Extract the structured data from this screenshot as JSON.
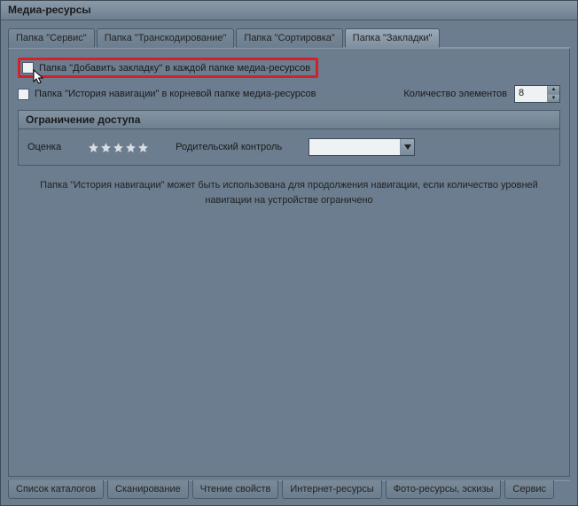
{
  "window": {
    "title": "Медиа-ресурсы"
  },
  "tabs_top": [
    {
      "label": "Папка \"Сервис\"",
      "active": false
    },
    {
      "label": "Папка \"Транскодирование\"",
      "active": false
    },
    {
      "label": "Папка \"Сортировка\"",
      "active": false
    },
    {
      "label": "Папка \"Закладки\"",
      "active": true
    }
  ],
  "options": {
    "add_bookmark_label": "Папка \"Добавить закладку\" в каждой папке  медиа-ресурсов",
    "nav_history_label": "Папка \"История навигации\" в корневой папке медиа-ресурсов",
    "elements_count_label": "Количество элементов",
    "elements_count_value": "8"
  },
  "access": {
    "group_title": "Ограничение доступа",
    "rating_label": "Оценка",
    "parental_label": "Родительский контроль",
    "parental_value": ""
  },
  "info": {
    "text": "Папка \"История навигации\" может быть использована для продолжения навигации, если количество уровней навигации на устройстве ограничено"
  },
  "tabs_bottom": [
    {
      "label": "Список каталогов"
    },
    {
      "label": "Сканирование"
    },
    {
      "label": "Чтение свойств"
    },
    {
      "label": "Интернет-ресурсы"
    },
    {
      "label": "Фото-ресурсы, эскизы"
    },
    {
      "label": "Сервис"
    }
  ]
}
